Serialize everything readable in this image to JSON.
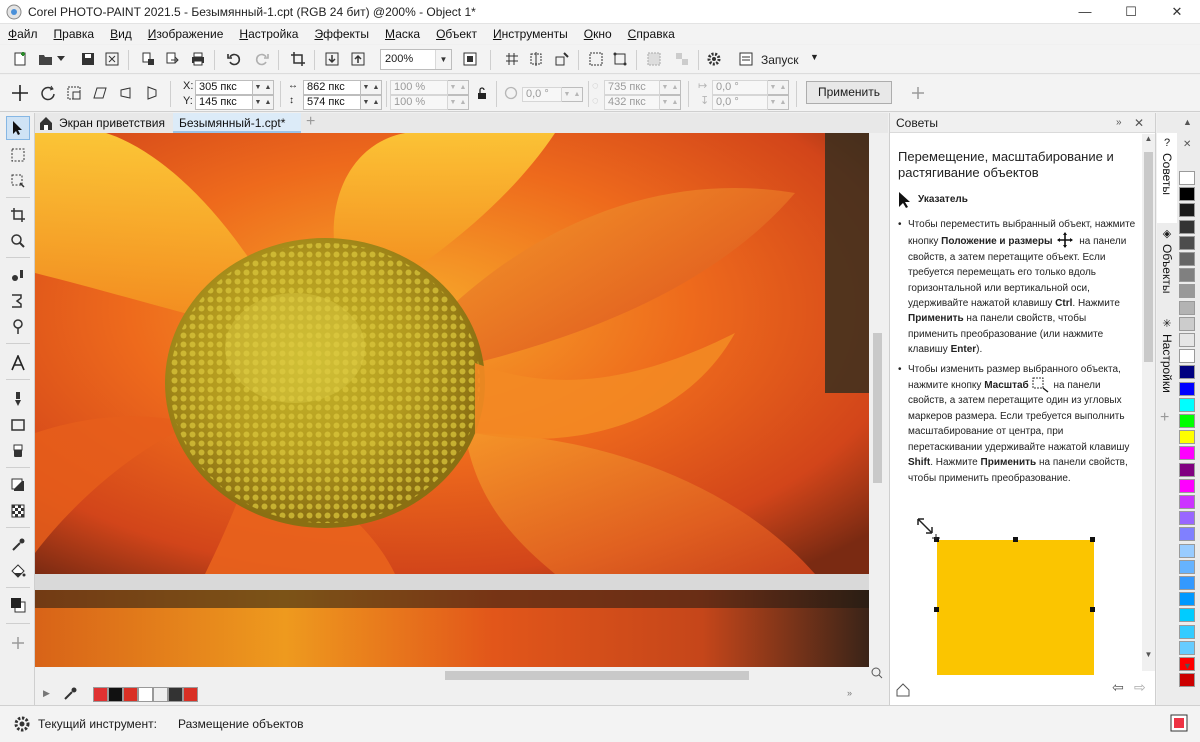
{
  "window": {
    "title": "Corel PHOTO-PAINT 2021.5 - Безымянный-1.cpt (RGB 24 бит) @200% - Object 1*",
    "minimize": "—",
    "maximize": "☐",
    "close": "✕"
  },
  "menu": [
    "Файл",
    "Правка",
    "Вид",
    "Изображение",
    "Настройка",
    "Эффекты",
    "Маска",
    "Объект",
    "Инструменты",
    "Окно",
    "Справка"
  ],
  "toolbar": {
    "zoom": "200%",
    "launch": "Запуск"
  },
  "property_bar": {
    "x_label": "X:",
    "x_value": "305 пкс",
    "y_label": "Y:",
    "y_value": "145 пкс",
    "width_value": "862 пкс",
    "height_value": "574 пкс",
    "scale_w": "100 %",
    "scale_h": "100 %",
    "angle": "0,0 °",
    "center_x": "735 пкс",
    "center_y": "432 пкс",
    "skew_h": "0,0 °",
    "skew_v": "0,0 °",
    "apply": "Применить"
  },
  "doc_tabs": {
    "welcome": "Экран приветствия",
    "document": "Безымянный-1.cpt*"
  },
  "docker": {
    "title": "Советы",
    "heading": "Перемещение, масштабирование и растягивание объектов",
    "tool_name": "Указатель",
    "bullet1": {
      "p1": "Чтобы переместить выбранный объект, нажмите кнопку ",
      "b1": "Положение и размеры",
      "p2": " на панели свойств, а затем перетащите объект. Если требуется перемещать его только вдоль горизонтальной или вертикальной оси, удерживайте нажатой клавишу ",
      "b2": "Ctrl",
      "p3": ". Нажмите ",
      "b3": "Применить",
      "p4": " на панели свойств, чтобы применить преобразование (или нажмите клавишу ",
      "b4": "Enter",
      "p5": ")."
    },
    "bullet2": {
      "p1": "Чтобы изменить размер выбранного объекта, нажмите кнопку ",
      "b1": "Масштаб",
      "p2": " на панели свойств, а затем перетащите один из угловых маркеров размера. Если требуется выполнить масштабирование от центра, при перетаскивании удерживайте нажатой клавишу ",
      "b2": "Shift",
      "p3": ". Нажмите ",
      "b3": "Применить",
      "p4": " на панели свойств, чтобы применить преобразование."
    }
  },
  "side_tabs": [
    "Советы",
    "Объекты",
    "Настройки"
  ],
  "palette_colors": [
    "#ffffff",
    "#000000",
    "#1a1a1a",
    "#333333",
    "#4d4d4d",
    "#666666",
    "#808080",
    "#999999",
    "#b3b3b3",
    "#cccccc",
    "#e6e6e6",
    "#ffffff",
    "#000080",
    "#0000ff",
    "#00ffff",
    "#00ff00",
    "#ffff00",
    "#ff00ff",
    "#800080",
    "#ff00ff",
    "#cc33ff",
    "#9966ff",
    "#8080ff",
    "#99ccff",
    "#66b3ff",
    "#3399ff",
    "#0099ff",
    "#00ccff",
    "#33ccff",
    "#66ccff",
    "#ff0000",
    "#cc0000"
  ],
  "doc_palette": [
    "#e03131",
    "#111111",
    "#d93025",
    "#ffffff",
    "#eeeeee",
    "#333333",
    "#d93025"
  ],
  "status": {
    "label": "Текущий инструмент:",
    "value": "Размещение объектов"
  }
}
